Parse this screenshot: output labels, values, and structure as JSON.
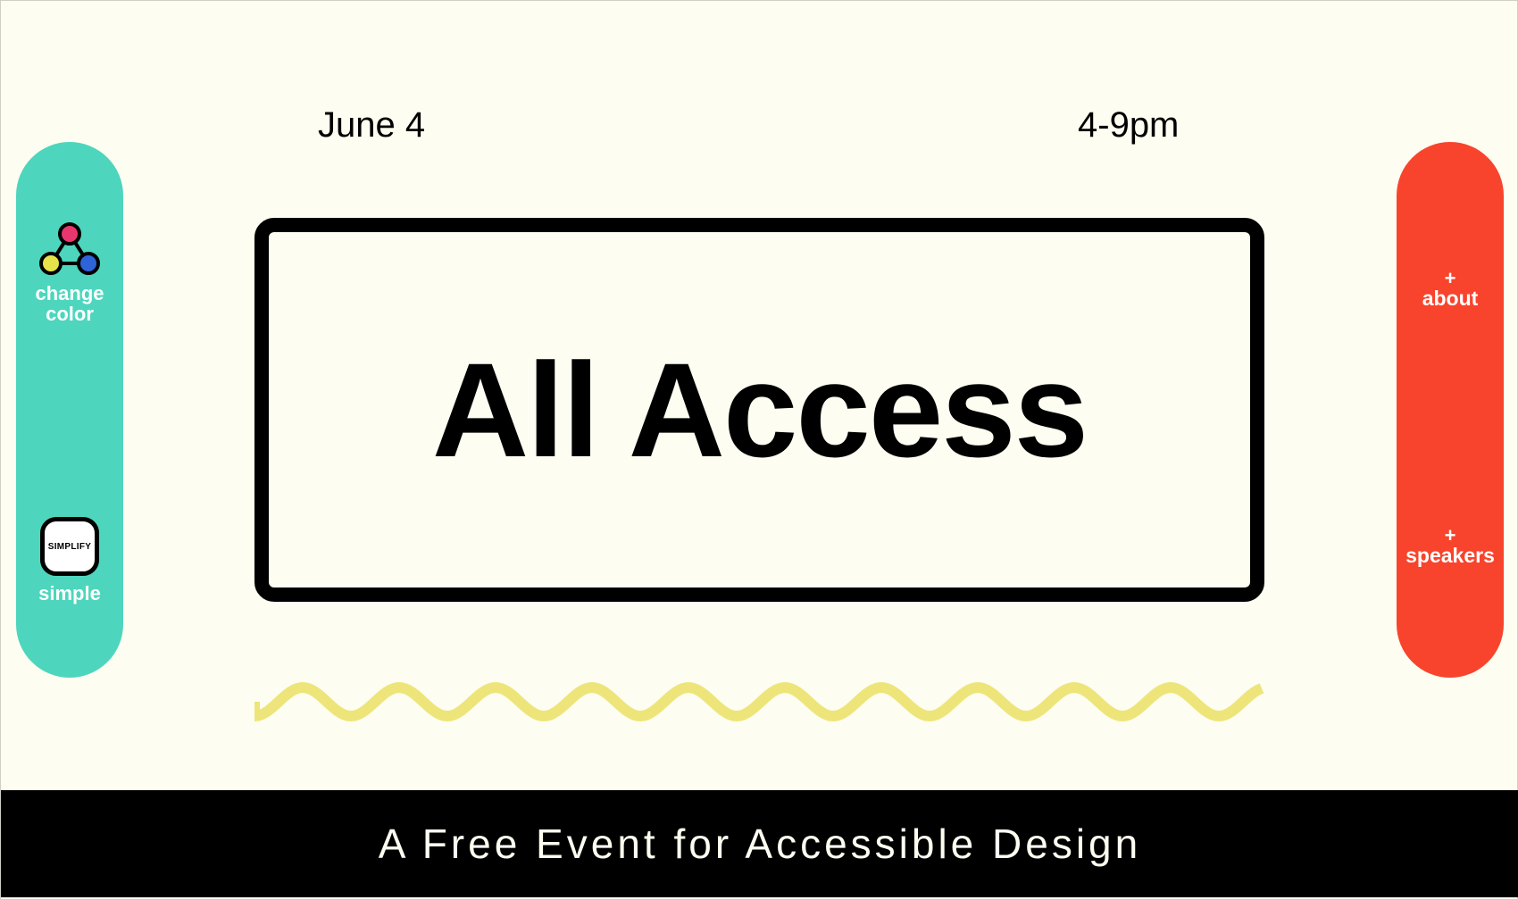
{
  "event": {
    "date": "June 4",
    "time": "4-9pm",
    "title": "All Access",
    "tagline": "A Free Event for Accessible Design"
  },
  "tools": {
    "change_color_label": "change color",
    "simplify_icon_text": "SIMPLIFY",
    "simple_label": "simple"
  },
  "nav": {
    "about_plus": "+",
    "about_label": "about",
    "speakers_plus": "+",
    "speakers_label": "speakers"
  },
  "colors": {
    "background": "#fdfdf1",
    "left_panel": "#4dd6bd",
    "right_panel": "#f8442c",
    "wave": "#eee57a",
    "footer": "#000000",
    "icon_pink": "#e8376f",
    "icon_yellow": "#e6e34a",
    "icon_blue": "#2f64d8"
  },
  "icons": {
    "color_icon": "color-palette-triangle-icon",
    "simplify_icon": "simplify-square-icon",
    "wave": "wavy-line-decoration"
  }
}
